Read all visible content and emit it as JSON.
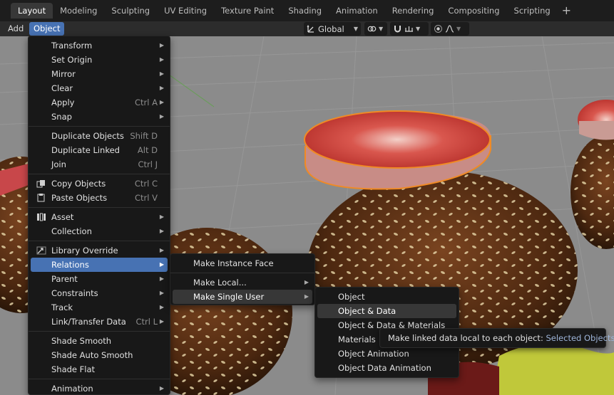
{
  "workspace_tabs": [
    "Layout",
    "Modeling",
    "Sculpting",
    "UV Editing",
    "Texture Paint",
    "Shading",
    "Animation",
    "Rendering",
    "Compositing",
    "Scripting"
  ],
  "add_tab_symbol": "+",
  "header": {
    "add_label": "Add",
    "object_label": "Object",
    "orientation": "Global"
  },
  "object_menu": [
    {
      "label": "Transform",
      "submenu": true
    },
    {
      "label": "Set Origin",
      "submenu": true
    },
    {
      "label": "Mirror",
      "submenu": true
    },
    {
      "label": "Clear",
      "submenu": true
    },
    {
      "label": "Apply",
      "shortcut": "Ctrl A",
      "submenu": true
    },
    {
      "label": "Snap",
      "submenu": true
    },
    {
      "label": "Duplicate Objects",
      "shortcut": "Shift D"
    },
    {
      "label": "Duplicate Linked",
      "shortcut": "Alt D"
    },
    {
      "label": "Join",
      "shortcut": "Ctrl J"
    },
    {
      "label": "Copy Objects",
      "shortcut": "Ctrl C",
      "icon": "copy-icon"
    },
    {
      "label": "Paste Objects",
      "shortcut": "Ctrl V",
      "icon": "paste-icon"
    },
    {
      "label": "Asset",
      "submenu": true,
      "icon": "asset-icon"
    },
    {
      "label": "Collection",
      "submenu": true
    },
    {
      "label": "Library Override",
      "submenu": true,
      "icon": "library-override-icon"
    },
    {
      "label": "Relations",
      "submenu": true
    },
    {
      "label": "Parent",
      "submenu": true
    },
    {
      "label": "Constraints",
      "submenu": true
    },
    {
      "label": "Track",
      "submenu": true
    },
    {
      "label": "Link/Transfer Data",
      "shortcut": "Ctrl L",
      "submenu": true
    },
    {
      "label": "Shade Smooth"
    },
    {
      "label": "Shade Auto Smooth"
    },
    {
      "label": "Shade Flat"
    },
    {
      "label": "Animation",
      "submenu": true
    }
  ],
  "relations_menu": [
    {
      "label": "Make Instance Face"
    },
    {
      "label": "Make Local...",
      "submenu": true
    },
    {
      "label": "Make Single User",
      "submenu": true
    }
  ],
  "single_user_menu": [
    {
      "label": "Object"
    },
    {
      "label": "Object & Data"
    },
    {
      "label": "Object & Data & Materials"
    },
    {
      "label": "Materials"
    },
    {
      "label": "Object Animation"
    },
    {
      "label": "Object Data Animation"
    }
  ],
  "tooltip": {
    "text": "Make linked data local to each object:",
    "value": "Selected Objects"
  },
  "colors": {
    "highlight": "#4772b3",
    "selection_outline": "#f08a24"
  }
}
